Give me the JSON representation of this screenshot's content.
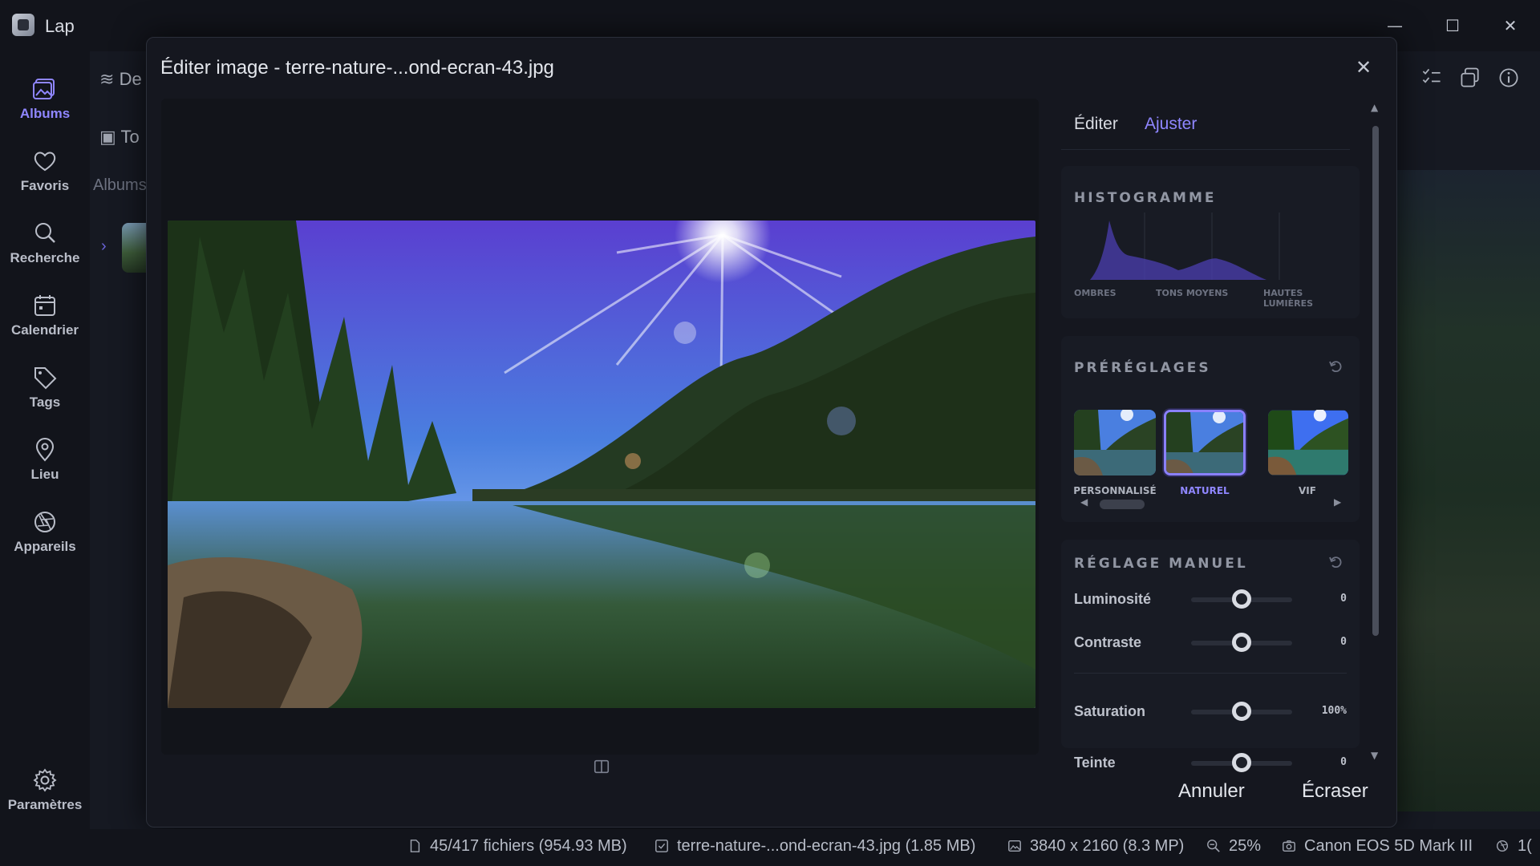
{
  "app": {
    "title": "Lap"
  },
  "window_controls": {
    "minimize": "—",
    "maximize": "☐",
    "close": "✕"
  },
  "sidebar": {
    "items": [
      {
        "label": "Albums",
        "icon": "albums-icon",
        "active": true
      },
      {
        "label": "Favoris",
        "icon": "heart-icon"
      },
      {
        "label": "Recherche",
        "icon": "search-icon"
      },
      {
        "label": "Calendrier",
        "icon": "calendar-icon"
      },
      {
        "label": "Tags",
        "icon": "tag-icon"
      },
      {
        "label": "Lieu",
        "icon": "location-pin-icon"
      },
      {
        "label": "Appareils",
        "icon": "camera-aperture-icon"
      }
    ],
    "settings": {
      "label": "Paramètres",
      "icon": "gear-icon"
    }
  },
  "background": {
    "items": [
      "De",
      "To",
      "Albums"
    ]
  },
  "dialog": {
    "title": "Éditer image - terre-nature-...ond-ecran-43.jpg",
    "close": "✕",
    "tabs": [
      {
        "label": "Éditer",
        "active": false
      },
      {
        "label": "Ajuster",
        "active": true
      }
    ],
    "histogram": {
      "title": "HISTOGRAMME",
      "labels": [
        "OMBRES",
        "TONS MOYENS",
        "HAUTES LUMIÈRES"
      ]
    },
    "presets": {
      "title": "PRÉRÉGLAGES",
      "items": [
        {
          "label": "PERSONNALISÉ",
          "selected": false
        },
        {
          "label": "NATUREL",
          "selected": true
        },
        {
          "label": "VIF",
          "selected": false
        }
      ]
    },
    "manual": {
      "title": "RÉGLAGE MANUEL",
      "sliders": [
        {
          "label": "Luminosité",
          "value": "0",
          "level": 0.5
        },
        {
          "label": "Contraste",
          "value": "0",
          "level": 0.5
        },
        {
          "label": "Saturation",
          "value": "100%",
          "level": 0.5
        },
        {
          "label": "Teinte",
          "value": "0",
          "level": 0.5
        }
      ]
    },
    "buttons": {
      "cancel": "Annuler",
      "overwrite": "Écraser"
    }
  },
  "statusbar": {
    "files": "45/417 fichiers (954.93 MB)",
    "file": "terre-nature-...ond-ecran-43.jpg (1.85 MB)",
    "dimensions": "3840 x 2160 (8.3 MP)",
    "zoom": "25%",
    "camera": "Canon EOS 5D Mark III",
    "extra": "1("
  },
  "colors": {
    "accent": "#8f86ff",
    "background": "#101219",
    "panel": "#181b24"
  }
}
